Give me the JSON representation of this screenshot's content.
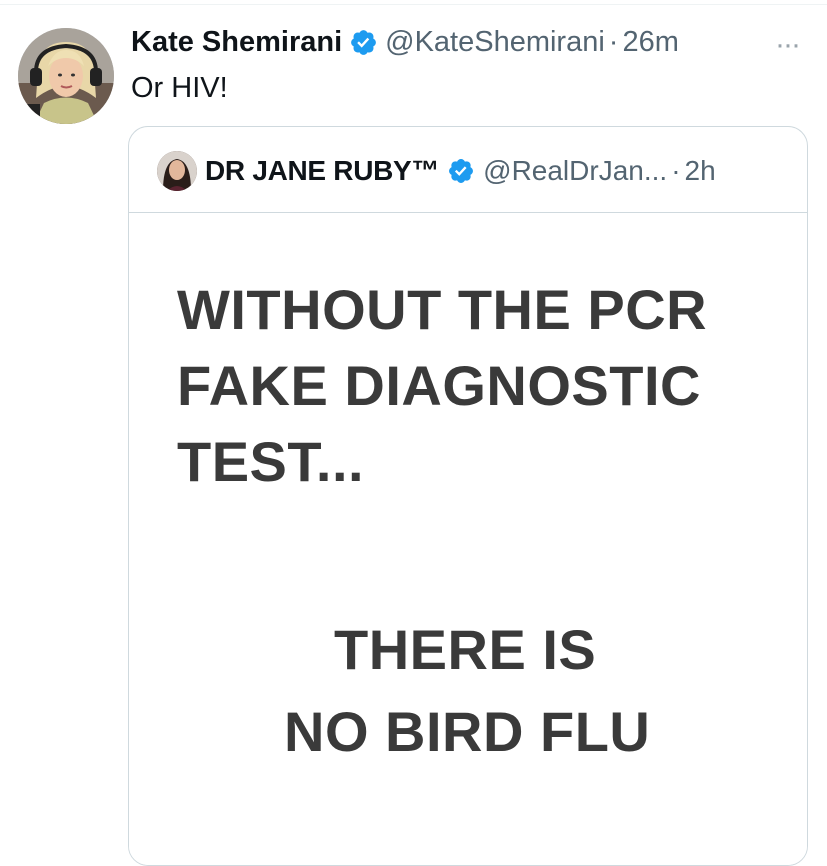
{
  "tweet": {
    "author_name": "Kate Shemirani",
    "handle": "@KateShemirani",
    "separator": "·",
    "time": "26m",
    "more_label": "···",
    "text": "Or HIV!"
  },
  "quoted_tweet": {
    "author_name": "DR JANE RUBY™",
    "handle": "@RealDrJan...",
    "separator": "·",
    "time": "2h",
    "media_text": {
      "line1": "WITHOUT THE PCR",
      "line2": "FAKE DIAGNOSTIC",
      "line3": "TEST...",
      "line4": "THERE IS",
      "line5": "NO BIRD FLU"
    }
  },
  "colors": {
    "verified_blue": "#1d9bf0",
    "text_primary": "#0f1419",
    "text_secondary": "#536471",
    "border": "#cfd9de",
    "media_text": "#3a3a3a"
  },
  "icons": {
    "verified": "verified-badge-icon",
    "more": "more-horizontal-icon"
  }
}
